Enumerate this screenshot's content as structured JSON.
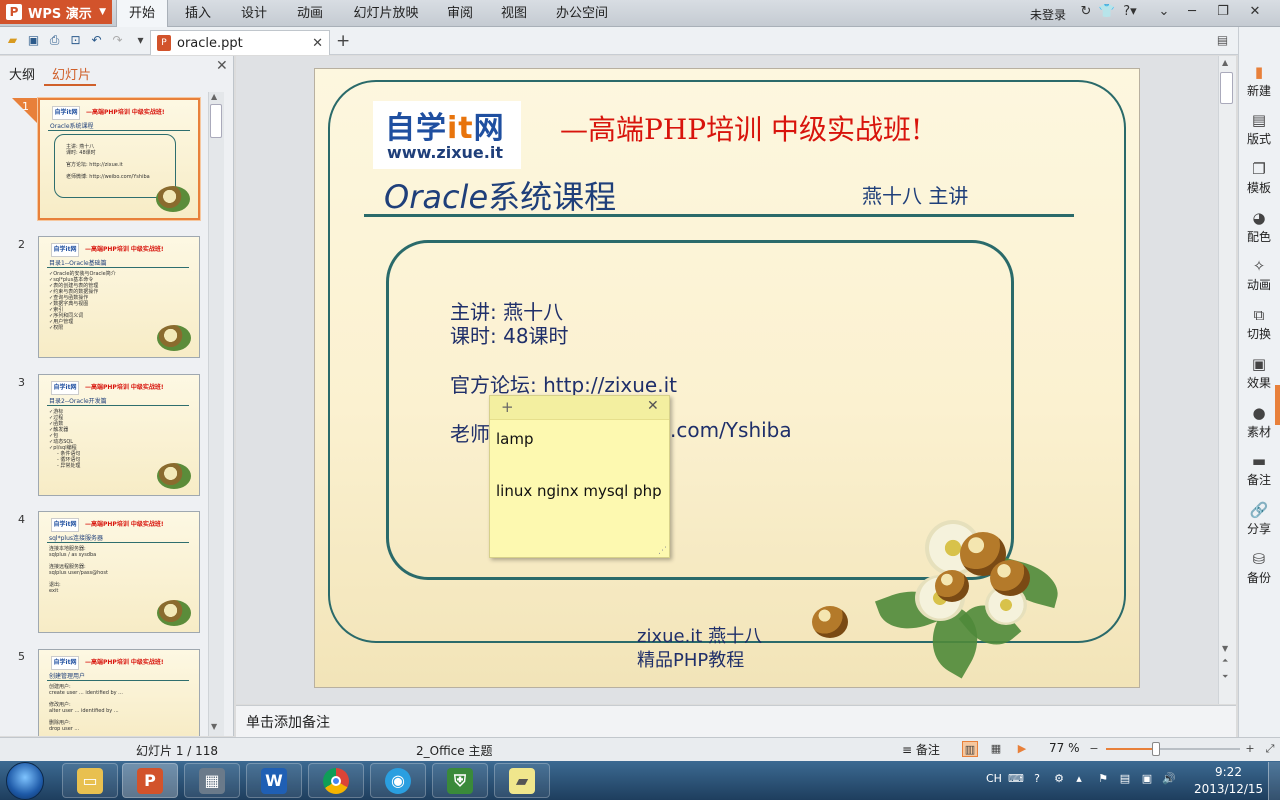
{
  "app": {
    "button_label": "WPS 演示"
  },
  "menu": {
    "items": [
      "开始",
      "插入",
      "设计",
      "动画",
      "幻灯片放映",
      "审阅",
      "视图",
      "办公空间"
    ],
    "active": "开始",
    "login": "未登录"
  },
  "file_tab": {
    "name": "oracle.ppt"
  },
  "left_panel": {
    "tab_outline": "大纲",
    "tab_slides": "幻灯片",
    "thumbnails": [
      {
        "num": "1",
        "title": "—高端PHP培训 中级实战班!",
        "sub": "Oracle系统课程",
        "body": "主讲: 燕十八\n课时: 48课时\n\n官方论坛: http://zixue.it\n\n老师微博: http://weibo.com/Yshiba"
      },
      {
        "num": "2",
        "title": "—高端PHP培训 中级实战班!",
        "sub": "目录1--Oracle基础篇",
        "body": "✓Oracle的安装与Oracle简介\n✓sql*plus基本命令\n✓表的创建与表的管理\n✓约束与表的数据操作\n✓查询与函数操作\n✓数据字典与视图\n✓索引\n✓序列和同义词\n✓用户管理\n✓权限"
      },
      {
        "num": "3",
        "title": "—高端PHP培训 中级实战班!",
        "sub": "目录2--Oracle开发篇",
        "body": "✓游标\n✓过程\n✓函数\n✓触发器\n✓包\n✓动态SQL\n✓pl/sql编程\n     - 条件语句\n     - 循环语句\n     - 异常处理"
      },
      {
        "num": "4",
        "title": "—高端PHP培训 中级实战班!",
        "sub": "sql*plus连接服务器",
        "body": "连接本地服务器:\nsqlplus / as sysdba\n\n连接远程服务器:\nsqlplus user/pass@host\n\n退出:\nexit"
      },
      {
        "num": "5",
        "title": "—高端PHP培训 中级实战班!",
        "sub": "创建管理用户",
        "body": "创建用户:\ncreate user ... identified by ...\n\n修改用户:\nalter user ... identified by ...\n\n删除用户:\ndrop user ..."
      }
    ]
  },
  "slide": {
    "logo_line1_a": "自学",
    "logo_line1_b": "it",
    "logo_line1_c": "网",
    "logo_line2": "www.zixue.it",
    "headline": "—高端PHP培训  中级实战班!",
    "course_en": "Oracle",
    "course_cn": "系统课程",
    "speaker": "燕十八 主讲",
    "lines": [
      "主讲: 燕十八",
      "课时: 48课时",
      "官方论坛: http://zixue.it",
      "老师",
      ".com/Yshiba"
    ],
    "footer1": "zixue.it 燕十八",
    "footer2": "精品PHP教程"
  },
  "sticky_note": {
    "line1": "lamp",
    "line2": "linux nginx mysql php"
  },
  "notes": {
    "placeholder": "单击添加备注"
  },
  "right_sidebar": {
    "items": [
      "新建",
      "版式",
      "模板",
      "配色",
      "动画",
      "切换",
      "效果",
      "素材",
      "备注",
      "分享",
      "备份"
    ]
  },
  "status": {
    "slide_count": "幻灯片 1 / 118",
    "theme": "2_Office 主题",
    "notes_label": "备注",
    "zoom": "77 %",
    "zoom_fraction": 0.77
  },
  "taskbar": {
    "tray_lang": "CH",
    "time": "9:22",
    "date": "2013/12/15"
  }
}
